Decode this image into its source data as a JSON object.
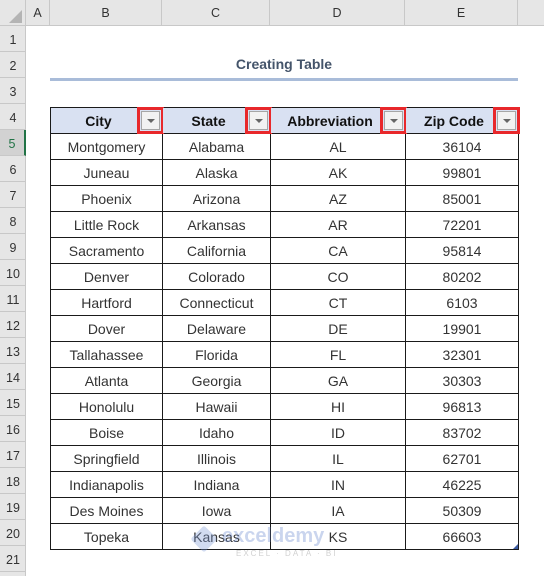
{
  "columns": [
    "A",
    "B",
    "C",
    "D",
    "E"
  ],
  "rows": [
    "1",
    "2",
    "3",
    "4",
    "5",
    "6",
    "7",
    "8",
    "9",
    "10",
    "11",
    "12",
    "13",
    "14",
    "15",
    "16",
    "17",
    "18",
    "19",
    "20",
    "21"
  ],
  "selected_row": "5",
  "title": "Creating Table",
  "table": {
    "headers": [
      "City",
      "State",
      "Abbreviation",
      "Zip Code"
    ],
    "rows": [
      [
        "Montgomery",
        "Alabama",
        "AL",
        "36104"
      ],
      [
        "Juneau",
        "Alaska",
        "AK",
        "99801"
      ],
      [
        "Phoenix",
        "Arizona",
        "AZ",
        "85001"
      ],
      [
        "Little Rock",
        "Arkansas",
        "AR",
        "72201"
      ],
      [
        "Sacramento",
        "California",
        "CA",
        "95814"
      ],
      [
        "Denver",
        "Colorado",
        "CO",
        "80202"
      ],
      [
        "Hartford",
        "Connecticut",
        "CT",
        "6103"
      ],
      [
        "Dover",
        "Delaware",
        "DE",
        "19901"
      ],
      [
        "Tallahassee",
        "Florida",
        "FL",
        "32301"
      ],
      [
        "Atlanta",
        "Georgia",
        "GA",
        "30303"
      ],
      [
        "Honolulu",
        "Hawaii",
        "HI",
        "96813"
      ],
      [
        "Boise",
        "Idaho",
        "ID",
        "83702"
      ],
      [
        "Springfield",
        "Illinois",
        "IL",
        "62701"
      ],
      [
        "Indianapolis",
        "Indiana",
        "IN",
        "46225"
      ],
      [
        "Des Moines",
        "Iowa",
        "IA",
        "50309"
      ],
      [
        "Topeka",
        "Kansas",
        "KS",
        "66603"
      ]
    ]
  },
  "icons": {
    "filter": "filter-dropdown-icon",
    "select_all": "select-all-triangle-icon"
  },
  "colors": {
    "header_fill": "#d9e1f2",
    "highlight_box": "#e8282b",
    "title_text": "#44546a",
    "title_underline": "#a9bcd9",
    "selection_green": "#217346"
  },
  "watermark": {
    "brand": "exceldemy",
    "tagline": "EXCEL · DATA · BI"
  }
}
